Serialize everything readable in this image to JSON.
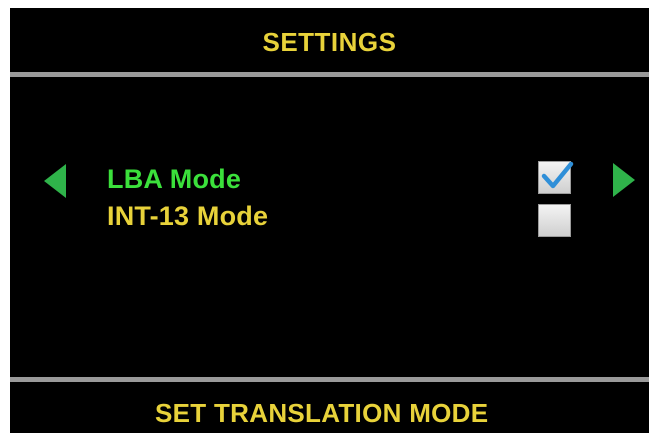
{
  "header": {
    "title": "SETTINGS"
  },
  "navigation": {
    "left_icon": "arrow-left-icon",
    "right_icon": "arrow-right-icon",
    "arrow_color": "#2fb34a"
  },
  "options": [
    {
      "label": "LBA Mode",
      "checked": true,
      "highlighted": true
    },
    {
      "label": "INT-13 Mode",
      "checked": false,
      "highlighted": false
    }
  ],
  "footer": {
    "hint": "SET TRANSLATION MODE"
  },
  "colors": {
    "background": "#000000",
    "text_yellow": "#e8d23a",
    "text_green_selected": "#3be03b",
    "divider": "#9a9a9a",
    "check_blue": "#2f8fd8"
  }
}
